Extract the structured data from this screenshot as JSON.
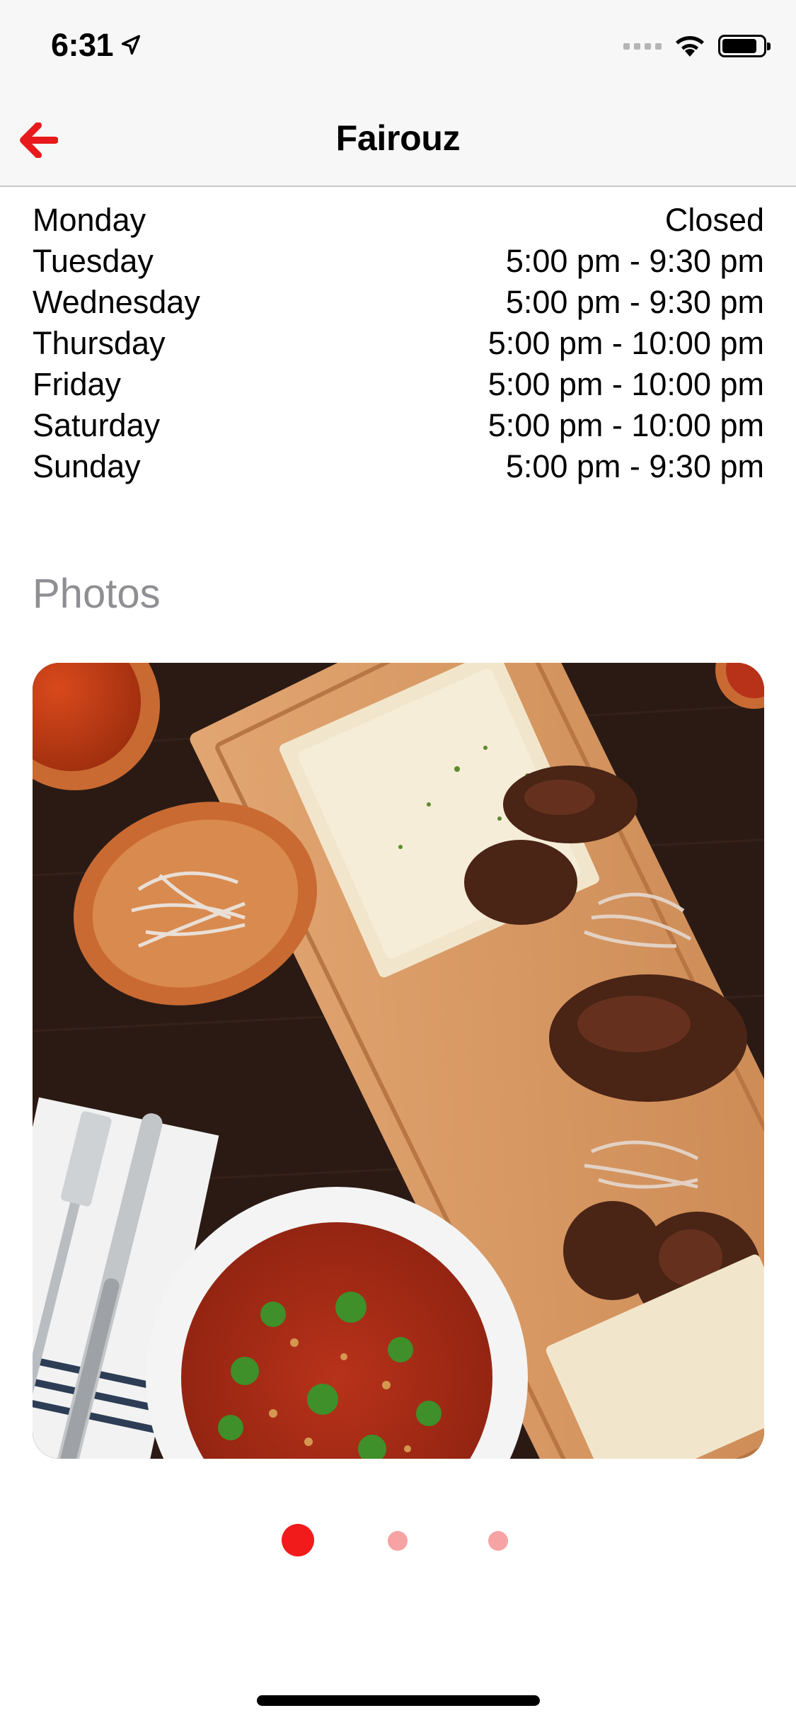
{
  "status_bar": {
    "time": "6:31",
    "location_icon": "location-arrow-icon",
    "signal_icon": "cellular-signal-icon",
    "wifi_icon": "wifi-icon",
    "battery_icon": "battery-icon",
    "battery_level": 0.85
  },
  "nav": {
    "title": "Fairouz",
    "back_icon": "back-arrow-icon",
    "accent_color": "#e8191c"
  },
  "hours": [
    {
      "day": "Monday",
      "time": "Closed"
    },
    {
      "day": "Tuesday",
      "time": "5:00 pm - 9:30 pm"
    },
    {
      "day": "Wednesday",
      "time": "5:00 pm - 9:30 pm"
    },
    {
      "day": "Thursday",
      "time": "5:00 pm - 10:00 pm"
    },
    {
      "day": "Friday",
      "time": "5:00 pm - 10:00 pm"
    },
    {
      "day": "Saturday",
      "time": "5:00 pm - 10:00 pm"
    },
    {
      "day": "Sunday",
      "time": "5:00 pm - 9:30 pm"
    }
  ],
  "photos": {
    "heading": "Photos",
    "count": 3,
    "current_index": 0,
    "active_dot_color": "#f21b1b",
    "inactive_dot_color": "#f7a3a3"
  },
  "colors": {
    "heading_gray": "#8e8e93",
    "bar_background": "#f7f7f7"
  }
}
